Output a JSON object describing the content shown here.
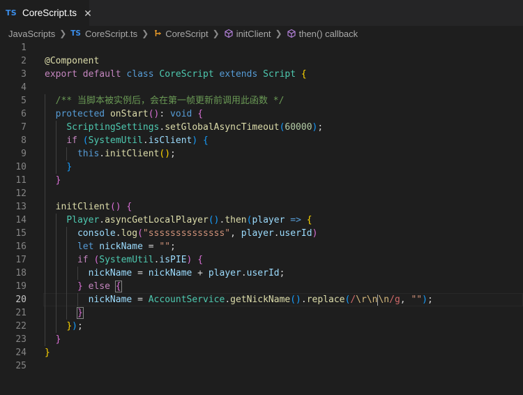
{
  "tab": {
    "badge": "TS",
    "label": "CoreScript.ts",
    "close": "✕"
  },
  "breadcrumb": {
    "folder": "JavaScripts",
    "file_badge": "TS",
    "file": "CoreScript.ts",
    "class_name": "CoreScript",
    "method": "initClient",
    "callback": "then() callback"
  },
  "colors": {
    "background": "#1e1e1e",
    "keyword": "#569cd6",
    "control": "#c586c0",
    "type": "#4ec9b0",
    "function": "#dcdcaa",
    "variable": "#9cdcfe",
    "string": "#ce9178",
    "number": "#b5cea8",
    "comment": "#6a9955"
  },
  "editor": {
    "active_line": 20,
    "lines": [
      {
        "n": "1",
        "indent": 0,
        "tokens": []
      },
      {
        "n": "2",
        "indent": 0,
        "tokens": [
          [
            "@Component",
            "fn"
          ]
        ]
      },
      {
        "n": "3",
        "indent": 0,
        "tokens": [
          [
            "export",
            "ctl"
          ],
          [
            " ",
            "pl"
          ],
          [
            "default",
            "ctl"
          ],
          [
            " ",
            "pl"
          ],
          [
            "class",
            "kw"
          ],
          [
            " ",
            "pl"
          ],
          [
            "CoreScript",
            "cls"
          ],
          [
            " ",
            "pl"
          ],
          [
            "extends",
            "kw"
          ],
          [
            " ",
            "pl"
          ],
          [
            "Script",
            "cls"
          ],
          [
            " ",
            "pl"
          ],
          [
            "{",
            "b1"
          ]
        ]
      },
      {
        "n": "4",
        "indent": 0,
        "tokens": []
      },
      {
        "n": "5",
        "indent": 1,
        "tokens": [
          [
            "  ",
            "pl"
          ],
          [
            "/** 当脚本被实例后，会在第一帧更新前调用此函数 */",
            "cmt"
          ]
        ]
      },
      {
        "n": "6",
        "indent": 1,
        "tokens": [
          [
            "  ",
            "pl"
          ],
          [
            "protected",
            "kw"
          ],
          [
            " ",
            "pl"
          ],
          [
            "onStart",
            "fn"
          ],
          [
            "()",
            "b2"
          ],
          [
            ": ",
            "pl"
          ],
          [
            "void",
            "kw"
          ],
          [
            " ",
            "pl"
          ],
          [
            "{",
            "b2"
          ]
        ]
      },
      {
        "n": "7",
        "indent": 2,
        "tokens": [
          [
            "    ",
            "pl"
          ],
          [
            "ScriptingSettings",
            "cls"
          ],
          [
            ".",
            "pl"
          ],
          [
            "setGlobalAsyncTimeout",
            "fn"
          ],
          [
            "(",
            "b3"
          ],
          [
            "60000",
            "num"
          ],
          [
            ")",
            "b3"
          ],
          [
            ";",
            "pl"
          ]
        ]
      },
      {
        "n": "8",
        "indent": 2,
        "tokens": [
          [
            "    ",
            "pl"
          ],
          [
            "if",
            "ctl"
          ],
          [
            " ",
            "pl"
          ],
          [
            "(",
            "b3"
          ],
          [
            "SystemUtil",
            "cls"
          ],
          [
            ".",
            "pl"
          ],
          [
            "isClient",
            "var"
          ],
          [
            ")",
            "b3"
          ],
          [
            " ",
            "pl"
          ],
          [
            "{",
            "b3"
          ]
        ]
      },
      {
        "n": "9",
        "indent": 3,
        "tokens": [
          [
            "      ",
            "pl"
          ],
          [
            "this",
            "kw"
          ],
          [
            ".",
            "pl"
          ],
          [
            "initClient",
            "fn"
          ],
          [
            "()",
            "b1"
          ],
          [
            ";",
            "pl"
          ]
        ]
      },
      {
        "n": "10",
        "indent": 2,
        "tokens": [
          [
            "    ",
            "pl"
          ],
          [
            "}",
            "b3"
          ]
        ]
      },
      {
        "n": "11",
        "indent": 1,
        "tokens": [
          [
            "  ",
            "pl"
          ],
          [
            "}",
            "b2"
          ]
        ]
      },
      {
        "n": "12",
        "indent": 1,
        "tokens": []
      },
      {
        "n": "13",
        "indent": 1,
        "tokens": [
          [
            "  ",
            "pl"
          ],
          [
            "initClient",
            "fn"
          ],
          [
            "()",
            "b2"
          ],
          [
            " ",
            "pl"
          ],
          [
            "{",
            "b2"
          ]
        ]
      },
      {
        "n": "14",
        "indent": 2,
        "tokens": [
          [
            "    ",
            "pl"
          ],
          [
            "Player",
            "cls"
          ],
          [
            ".",
            "pl"
          ],
          [
            "asyncGetLocalPlayer",
            "fn"
          ],
          [
            "()",
            "b3"
          ],
          [
            ".",
            "pl"
          ],
          [
            "then",
            "fn"
          ],
          [
            "(",
            "b3"
          ],
          [
            "player",
            "var"
          ],
          [
            " ",
            "pl"
          ],
          [
            "=>",
            "kw"
          ],
          [
            " ",
            "pl"
          ],
          [
            "{",
            "b1"
          ]
        ]
      },
      {
        "n": "15",
        "indent": 3,
        "tokens": [
          [
            "      ",
            "pl"
          ],
          [
            "console",
            "var"
          ],
          [
            ".",
            "pl"
          ],
          [
            "log",
            "fn"
          ],
          [
            "(",
            "b2"
          ],
          [
            "\"ssssssssssssss\"",
            "str"
          ],
          [
            ", ",
            "pl"
          ],
          [
            "player",
            "var"
          ],
          [
            ".",
            "pl"
          ],
          [
            "userId",
            "var"
          ],
          [
            ")",
            "b2"
          ]
        ]
      },
      {
        "n": "16",
        "indent": 3,
        "tokens": [
          [
            "      ",
            "pl"
          ],
          [
            "let",
            "kw"
          ],
          [
            " ",
            "pl"
          ],
          [
            "nickName",
            "var"
          ],
          [
            " = ",
            "pl"
          ],
          [
            "\"\"",
            "str"
          ],
          [
            ";",
            "pl"
          ]
        ]
      },
      {
        "n": "17",
        "indent": 3,
        "tokens": [
          [
            "      ",
            "pl"
          ],
          [
            "if",
            "ctl"
          ],
          [
            " ",
            "pl"
          ],
          [
            "(",
            "b2"
          ],
          [
            "SystemUtil",
            "cls"
          ],
          [
            ".",
            "pl"
          ],
          [
            "isPIE",
            "var"
          ],
          [
            ")",
            "b2"
          ],
          [
            " ",
            "pl"
          ],
          [
            "{",
            "b2"
          ]
        ]
      },
      {
        "n": "18",
        "indent": 4,
        "tokens": [
          [
            "        ",
            "pl"
          ],
          [
            "nickName",
            "var"
          ],
          [
            " = ",
            "pl"
          ],
          [
            "nickName",
            "var"
          ],
          [
            " + ",
            "pl"
          ],
          [
            "player",
            "var"
          ],
          [
            ".",
            "pl"
          ],
          [
            "userId",
            "var"
          ],
          [
            ";",
            "pl"
          ]
        ]
      },
      {
        "n": "19",
        "indent": 3,
        "tokens": [
          [
            "      ",
            "pl"
          ],
          [
            "}",
            "b2"
          ],
          [
            " ",
            "pl"
          ],
          [
            "else",
            "ctl"
          ],
          [
            " ",
            "pl"
          ],
          [
            "{",
            "b2 bmatch"
          ]
        ]
      },
      {
        "n": "20",
        "indent": 4,
        "tokens": [
          [
            "        ",
            "pl"
          ],
          [
            "nickName",
            "var"
          ],
          [
            " = ",
            "pl"
          ],
          [
            "AccountService",
            "cls"
          ],
          [
            ".",
            "pl"
          ],
          [
            "getNickName",
            "fn"
          ],
          [
            "()",
            "b3"
          ],
          [
            ".",
            "pl"
          ],
          [
            "replace",
            "fn"
          ],
          [
            "(",
            "b3"
          ],
          [
            "/",
            "rx"
          ],
          [
            "\\r\\n",
            "esc"
          ],
          [
            "|",
            "cursor"
          ],
          [
            "\\n",
            "esc"
          ],
          [
            "/g",
            "rx"
          ],
          [
            ", ",
            "pl"
          ],
          [
            "\"\"",
            "str"
          ],
          [
            ")",
            "b3"
          ],
          [
            ";",
            "pl"
          ]
        ]
      },
      {
        "n": "21",
        "indent": 3,
        "tokens": [
          [
            "      ",
            "pl"
          ],
          [
            "}",
            "b2 bmatch"
          ]
        ]
      },
      {
        "n": "22",
        "indent": 2,
        "tokens": [
          [
            "    ",
            "pl"
          ],
          [
            "}",
            "b1"
          ],
          [
            ")",
            "b3"
          ],
          [
            ";",
            "pl"
          ]
        ]
      },
      {
        "n": "23",
        "indent": 1,
        "tokens": [
          [
            "  ",
            "pl"
          ],
          [
            "}",
            "b2"
          ]
        ]
      },
      {
        "n": "24",
        "indent": 0,
        "tokens": [
          [
            "}",
            "b1"
          ]
        ]
      },
      {
        "n": "25",
        "indent": 0,
        "tokens": []
      }
    ]
  }
}
